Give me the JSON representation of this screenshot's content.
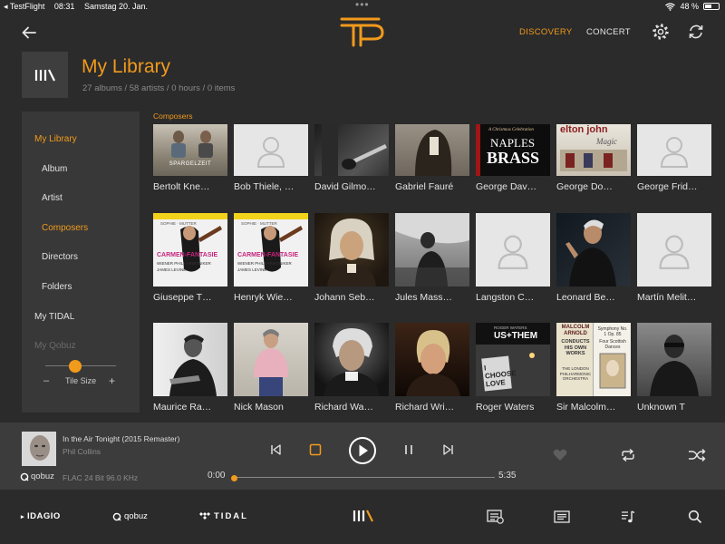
{
  "statusbar": {
    "app": "◂ TestFlight",
    "time": "08:31",
    "date": "Samstag 20. Jan.",
    "battery": "48 %"
  },
  "topbar": {
    "discovery": "DISCOVERY",
    "concert": "CONCERT"
  },
  "header": {
    "title": "My Library",
    "stats": "27 albums / 58 artists /  0 hours / 0 items"
  },
  "sidebar": {
    "items": [
      "My Library",
      "Album",
      "Artist",
      "Composers",
      "Directors",
      "Folders",
      "My TIDAL",
      "My Qobuz"
    ],
    "tile_size_label": "Tile Size",
    "minus": "–",
    "plus": "+",
    "tile_size_level": 0.33
  },
  "grid": {
    "section": "Composers",
    "rows": [
      [
        "Bertolt Kne…",
        "Bob Thiele, …",
        "David Gilmo…",
        "Gabriel Fauré",
        "George Dav…",
        "George Do…",
        "George Frid…"
      ],
      [
        "Giuseppe T…",
        "Henryk Wie…",
        "Johann Seb…",
        "Jules Mass…",
        "Langston C…",
        "Leonard Be…",
        "Martín Melit…"
      ],
      [
        "Maurice Ra…",
        "Nick Mason",
        "Richard Wa…",
        "Richard Wri…",
        "Roger Waters",
        "Sir Malcolm…",
        "Unknown T"
      ]
    ],
    "art_text": {
      "sparge": "SPARGELZEIT",
      "naples_script": "A Christmas Celebration",
      "naples_title": "NAPLES",
      "naples_brass": "BRASS",
      "magic_title": "elton john",
      "magic_sub": "Magic",
      "carmen_top": "SOPHIE · MUTTER",
      "carmen_title": "CARMEN-FANTASIE",
      "carmen_sub": "WIENER PHILHARMONIKER",
      "carmen_cond": "JAMES LEVINE",
      "usthem": "US+THEM",
      "usthem_top": "ROGER WATERS",
      "usthem_sign": "I CHOOSE LOVE",
      "malcolm_name": "MALCOLM ARNOLD",
      "malcolm_works": "CONDUCTS HIS OWN WORKS",
      "malcolm_orch": "THE LONDON PHILHARMONIC ORCHESTRA",
      "symphony": "Symphony No. 1 Op. 85",
      "dances": "Four Scottish Dances"
    }
  },
  "player": {
    "title": "In the Air Tonight  (2015 Remaster)",
    "artist": "Phil Collins",
    "format": "FLAC 24 Bit 96.0 KHz",
    "source": "qobuz",
    "elapsed": "0:00",
    "duration": "5:35",
    "progress": 0
  },
  "bottombar": {
    "idagio": "IDAGIO",
    "qobuz": "qobuz",
    "tidal": "TIDAL"
  },
  "colors": {
    "accent": "#f19a1c",
    "background": "#2b2b2b",
    "panel": "#383838",
    "player": "#3c3c3c"
  },
  "icons": [
    "back-arrow-icon",
    "gear-icon",
    "sync-icon",
    "previous-icon",
    "stop-icon",
    "play-icon",
    "pause-icon",
    "next-icon",
    "heart-icon",
    "repeat-icon",
    "shuffle-icon",
    "library-icon",
    "queue-icon",
    "notes-icon",
    "playlist-icon",
    "search-icon"
  ]
}
